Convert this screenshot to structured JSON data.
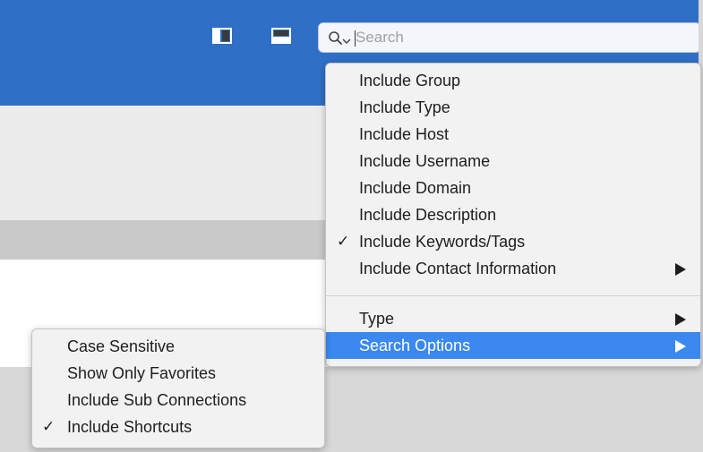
{
  "toolbar": {
    "sidebar_icon": "sidebar-toggle-icon",
    "bottom_panel_icon": "bottom-panel-toggle-icon",
    "search": {
      "placeholder": "Search",
      "value": "",
      "icon": "search-icon",
      "chevron": "chevron-down-icon"
    }
  },
  "search_menu": {
    "items": [
      {
        "label": "Include Group",
        "checked": false,
        "submenu": false
      },
      {
        "label": "Include Type",
        "checked": false,
        "submenu": false
      },
      {
        "label": "Include Host",
        "checked": false,
        "submenu": false
      },
      {
        "label": "Include Username",
        "checked": false,
        "submenu": false
      },
      {
        "label": "Include Domain",
        "checked": false,
        "submenu": false
      },
      {
        "label": "Include Description",
        "checked": false,
        "submenu": false
      },
      {
        "label": "Include Keywords/Tags",
        "checked": true,
        "submenu": false
      },
      {
        "label": "Include Contact Information",
        "checked": false,
        "submenu": true
      }
    ],
    "lower_items": [
      {
        "label": "Type",
        "submenu": true,
        "highlighted": false
      },
      {
        "label": "Search Options",
        "submenu": true,
        "highlighted": true
      }
    ],
    "check_glyph": "✓"
  },
  "search_options_submenu": {
    "items": [
      {
        "label": "Case Sensitive",
        "checked": false
      },
      {
        "label": "Show Only Favorites",
        "checked": false
      },
      {
        "label": "Include Sub Connections",
        "checked": false
      },
      {
        "label": "Include Shortcuts",
        "checked": true
      }
    ]
  },
  "colors": {
    "titlebar": "#2f6fc6",
    "highlight": "#3a88f0",
    "menu_bg": "#f2f2f2"
  }
}
